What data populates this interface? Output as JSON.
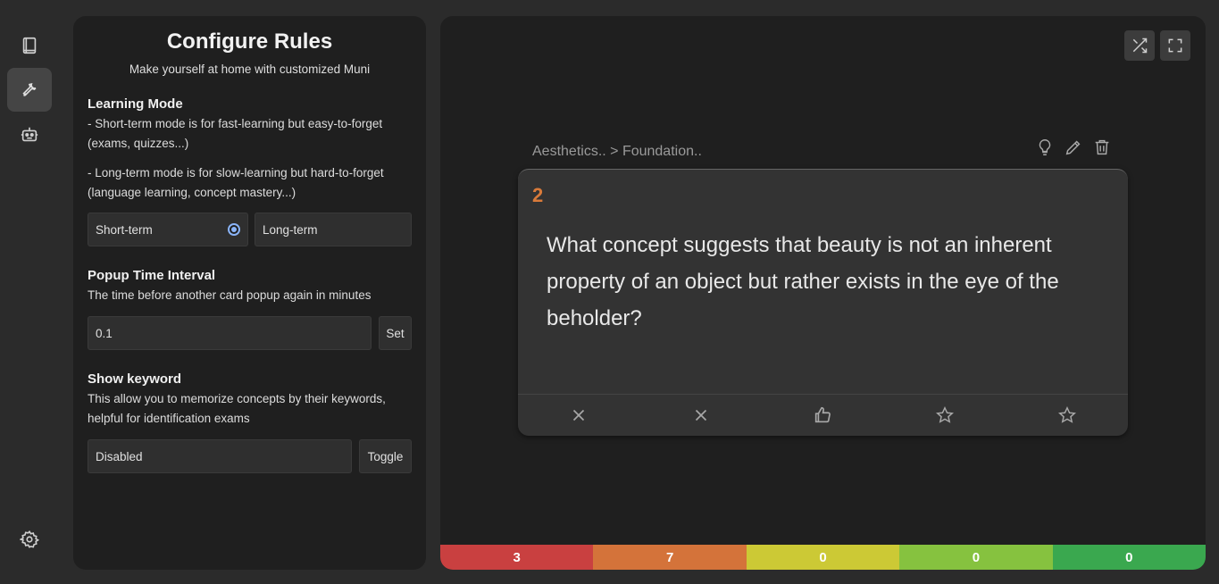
{
  "rail": {
    "items": [
      {
        "icon": "book-icon",
        "active": false
      },
      {
        "icon": "wrench-icon",
        "active": true
      },
      {
        "icon": "robot-icon",
        "active": false
      }
    ],
    "bottom_icon": "gear-icon"
  },
  "config": {
    "title": "Configure Rules",
    "subtitle": "Make yourself at home with customized Muni",
    "learning_mode": {
      "title": "Learning Mode",
      "desc_short": "- Short-term mode is for fast-learning but easy-to-forget (exams, quizzes...)",
      "desc_long": "- Long-term mode is for slow-learning but hard-to-forget (language learning, concept mastery...)",
      "option_short": "Short-term",
      "option_long": "Long-term",
      "selected": "Short-term"
    },
    "popup_interval": {
      "title": "Popup Time Interval",
      "desc": "The time before another card popup again in minutes",
      "value": "0.1",
      "button": "Set"
    },
    "show_keyword": {
      "title": "Show keyword",
      "desc": "This allow you to memorize concepts by their keywords, helpful for identification exams",
      "value": "Disabled",
      "button": "Toggle"
    }
  },
  "main": {
    "top_icons": [
      "shuffle-icon",
      "fullscreen-icon"
    ],
    "breadcrumb": "Aesthetics.. > Foundation..",
    "card_tools": [
      "lightbulb-icon",
      "pencil-icon",
      "trash-icon"
    ],
    "card": {
      "number": "2",
      "question": "What concept suggests that beauty is not an inherent property of an object but rather exists in the eye of the beholder?",
      "actions": [
        "close-icon",
        "close-icon",
        "thumbs-up-icon",
        "star-icon",
        "star-icon"
      ]
    },
    "stats": [
      {
        "value": "3",
        "color": "#c94040"
      },
      {
        "value": "7",
        "color": "#d4733a"
      },
      {
        "value": "0",
        "color": "#ccc935"
      },
      {
        "value": "0",
        "color": "#86c23f"
      },
      {
        "value": "0",
        "color": "#3aa84f"
      }
    ]
  }
}
